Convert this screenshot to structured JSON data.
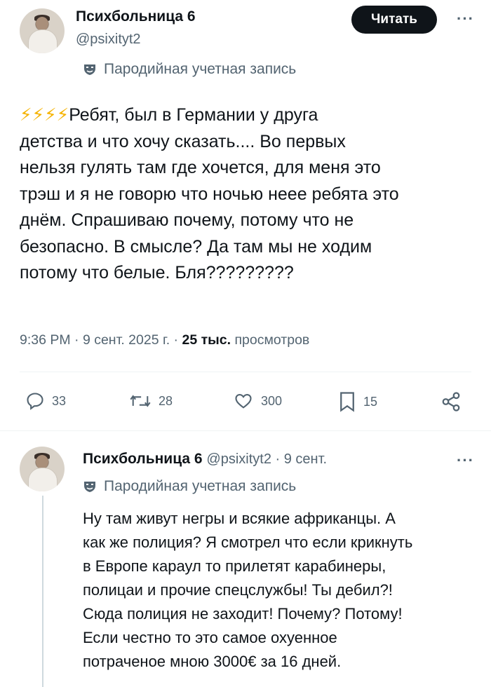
{
  "tweet": {
    "author_name": "Психбольница 6",
    "handle": "@psixityt2",
    "follow_label": "Читать",
    "more_label": "···",
    "parody_label": "Пародийная учетная запись",
    "emoji": "⚡⚡⚡⚡",
    "lines": [
      "Ребят, был в Германии у друга",
      "детства и что хочу сказать.... Во первых",
      "нельзя гулять там где хочется, для меня это",
      "трэш и я не говорю что ночью неее ребята это",
      "днём. Спрашиваю почему, потому что не",
      "безопасно. В смысле? Да там мы не ходим",
      "потому что белые. Бля?????????"
    ],
    "timestamp": "9:36 PM · 9 сент. 2025 г. · ",
    "views_count": "25 тыс.",
    "views_label": "просмотров",
    "actions": {
      "replies": "33",
      "retweets": "28",
      "likes": "300",
      "bookmarks": "15"
    }
  },
  "reply": {
    "author_name": "Психбольница 6",
    "handle_date": "@psixityt2 · 9 сент.",
    "more_label": "···",
    "parody_label": "Пародийная учетная запись",
    "lines": [
      "Ну там живут негры и всякие африканцы. А",
      "как же полиция? Я смотрел что если крикнуть",
      "в Европе караул то прилетят карабинеры,",
      "полицаи и прочие спецслужбы! Ты дебил?!",
      "Сюда полиция не заходит! Почему? Потому!",
      "Если честно то это самое охуенное",
      "потраченое мною 3000€ за 16 дней."
    ]
  },
  "colors": {
    "accent": "#0f1419",
    "muted": "#536471",
    "bolt": "#f5b301"
  },
  "icons": [
    "mask-icon",
    "reply-icon",
    "retweet-icon",
    "like-icon",
    "bookmark-icon",
    "share-icon"
  ]
}
